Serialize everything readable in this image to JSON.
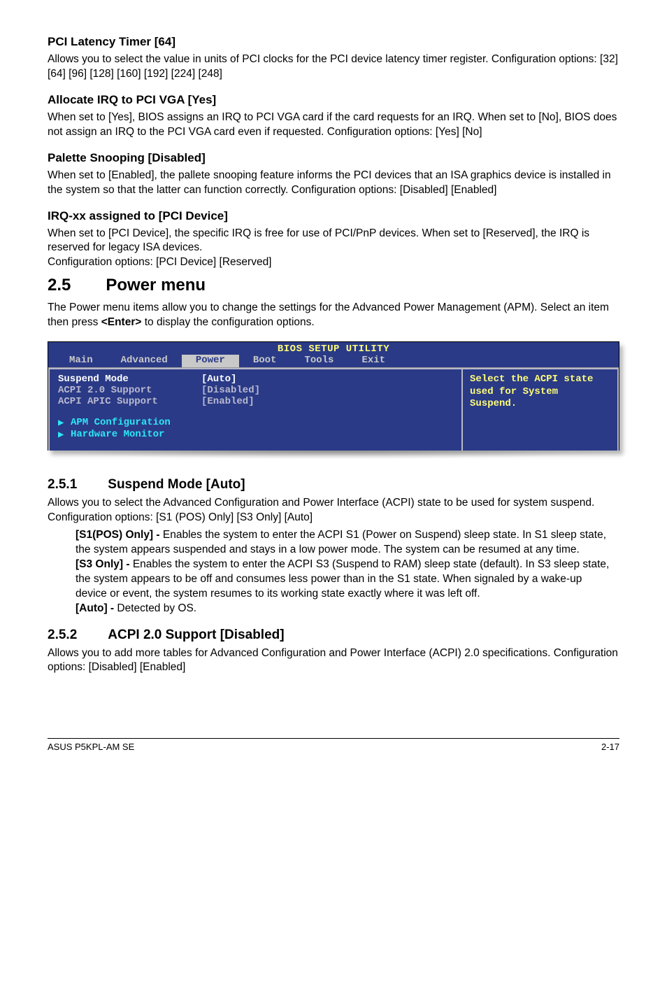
{
  "s1": {
    "h": "PCI Latency Timer [64]",
    "p": "Allows you to select the value in units of PCI clocks for the PCI device latency timer register. Configuration options: [32] [64] [96] [128] [160] [192] [224] [248]"
  },
  "s2": {
    "h": "Allocate IRQ to PCI VGA [Yes]",
    "p": "When set to [Yes], BIOS assigns an IRQ to PCI VGA card if the card requests for an IRQ. When set to [No], BIOS does not assign an IRQ to the PCI VGA card even if requested. Configuration options: [Yes] [No]"
  },
  "s3": {
    "h": "Palette Snooping [Disabled]",
    "p": "When set to [Enabled], the pallete snooping feature informs the PCI devices that an ISA graphics device is installed in the system so that the latter can function correctly. Configuration options: [Disabled] [Enabled]"
  },
  "s4": {
    "h": "IRQ-xx assigned to [PCI Device]",
    "p1": "When set to [PCI Device], the specific IRQ is free for use of PCI/PnP devices. When set to [Reserved], the IRQ is reserved for legacy ISA devices.",
    "p2": "Configuration options: [PCI Device] [Reserved]"
  },
  "sec25": {
    "num": "2.5",
    "title": "Power menu",
    "p_a": "The Power menu items allow you to change the settings for the Advanced Power Management (APM). Select an item then press ",
    "key": "<Enter>",
    "p_b": " to display the configuration options."
  },
  "bios": {
    "title": "BIOS SETUP UTILITY",
    "tabs": [
      "Main",
      "Advanced",
      "Power",
      "Boot",
      "Tools",
      "Exit"
    ],
    "rows": [
      {
        "label": "Suspend Mode",
        "value": "[Auto]",
        "sel": true
      },
      {
        "label": "ACPI 2.0 Support",
        "value": "[Disabled]",
        "sel": false
      },
      {
        "label": "ACPI APIC Support",
        "value": "[Enabled]",
        "sel": false
      }
    ],
    "links": [
      "APM Configuration",
      "Hardware Monitor"
    ],
    "help": "Select the ACPI state used for System Suspend."
  },
  "s251": {
    "num": "2.5.1",
    "title": "Suspend Mode [Auto]",
    "p": "Allows you to select the Advanced Configuration and Power Interface (ACPI) state to be used for system suspend. Configuration options: [S1 (POS) Only] [S3 Only] [Auto]",
    "b1h": "[S1(POS) Only] - ",
    "b1": "Enables the system to enter the ACPI S1 (Power on Suspend) sleep state. In S1 sleep state, the system appears suspended and stays in a low power mode. The system can be resumed at any time.",
    "b2h": "[S3 Only] - ",
    "b2": "Enables the system to enter the ACPI S3 (Suspend to RAM) sleep state (default). In S3 sleep state, the system appears to be off and consumes less power than in the S1 state. When signaled by a wake-up device or event, the system resumes to its working state exactly where it was left off.",
    "b3h": "[Auto] - ",
    "b3": "Detected by OS."
  },
  "s252": {
    "num": "2.5.2",
    "title": "ACPI 2.0 Support [Disabled]",
    "p": "Allows you to add more tables for Advanced Configuration and Power Interface (ACPI) 2.0 specifications. Configuration options: [Disabled] [Enabled]"
  },
  "footer": {
    "left": "ASUS P5KPL-AM SE",
    "right": "2-17"
  }
}
